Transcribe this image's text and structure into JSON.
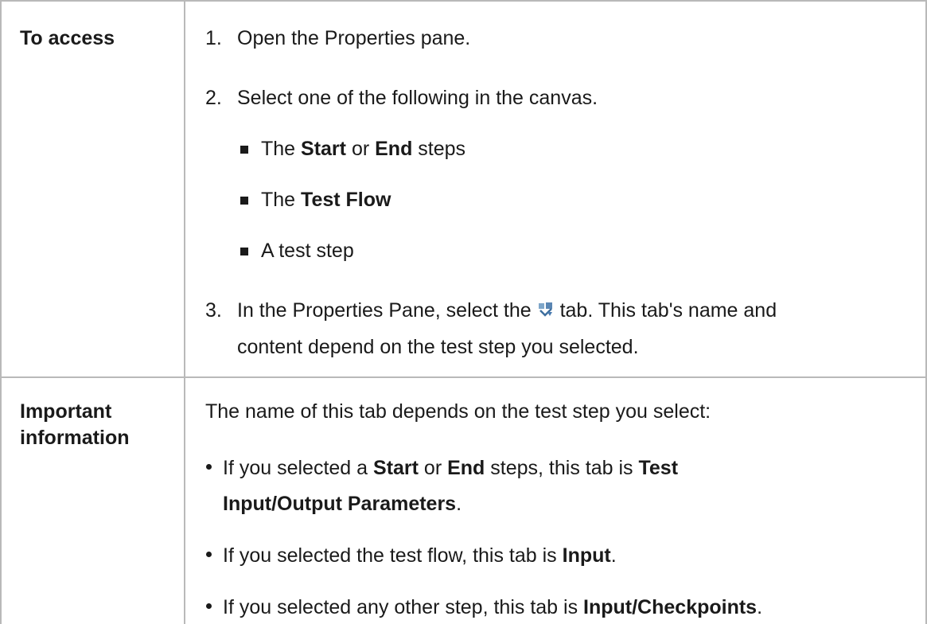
{
  "row1": {
    "label": "To access",
    "step1_num": "1.",
    "step1": "Open the Properties pane.",
    "step2_num": "2.",
    "step2": "Select one of the following in the canvas.",
    "bullet1": {
      "a": "The ",
      "b1": "Start",
      "c": " or ",
      "b2": "End",
      "d": " steps"
    },
    "bullet2": {
      "a": "The ",
      "b1": "Test Flow"
    },
    "bullet3": "A test step",
    "step3_num": "3.",
    "step3_a": "In the Properties Pane, select the ",
    "step3_b": " tab. This tab's name and",
    "step3_line2": "content depend on the test step you selected.",
    "tab_icon": "input-checkpoints-tab-icon"
  },
  "row2": {
    "label_line1": "Important",
    "label_line2": "information",
    "intro": "The name of this tab depends on the test step you select:",
    "item1": {
      "a": "If you selected a ",
      "b1": "Start",
      "c": " or ",
      "b2": "End",
      "d": " steps, this tab is ",
      "b3": "Test"
    },
    "item1_line2": {
      "b": "Input/Output Parameters",
      "e": "."
    },
    "item2": {
      "a": "If you selected the test flow, this tab is ",
      "b": "Input",
      "c": "."
    },
    "item3": {
      "a": "If you selected any other step, this tab is ",
      "b": "Input/Checkpoints",
      "c": "."
    }
  }
}
